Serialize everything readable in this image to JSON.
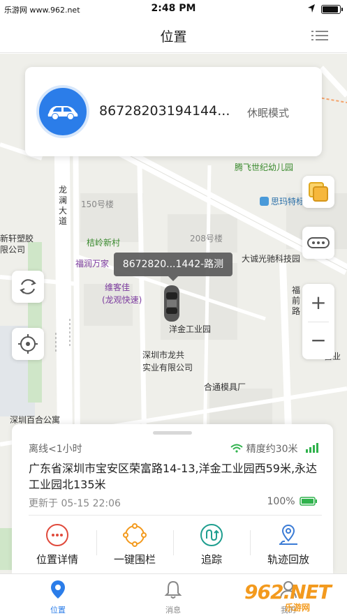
{
  "status_bar": {
    "carrier": "乐游网 www.962.net",
    "time": "2:48 PM"
  },
  "nav": {
    "title": "位置",
    "menu_icon": "list-menu-icon"
  },
  "map": {
    "pois": [
      {
        "name": "poi-tengfei-kindergarten",
        "label": "腾飞世纪幼儿园",
        "color": "green"
      },
      {
        "name": "poi-simatek",
        "label": "思玛特标",
        "color": "blue"
      },
      {
        "name": "poi-150",
        "label": "150号楼",
        "color": "gray"
      },
      {
        "name": "poi-208",
        "label": "208号楼",
        "color": "gray"
      },
      {
        "name": "poi-longlan-dadao",
        "label": "龙澜大道",
        "color": "dark"
      },
      {
        "name": "poi-jieling-xincun",
        "label": "桔岭新村",
        "color": "green"
      },
      {
        "name": "poi-futunwanjia",
        "label": "福润万家",
        "color": "purple"
      },
      {
        "name": "poi-weikejia",
        "label": "维客佳",
        "color": "purple"
      },
      {
        "name": "poi-weikejia-sub",
        "label": "(龙观快速)",
        "color": "purple"
      },
      {
        "name": "poi-dacheng",
        "label": "大诚光驰科技园",
        "color": "dark"
      },
      {
        "name": "poi-yangjin",
        "label": "洋金工业园",
        "color": "dark"
      },
      {
        "name": "poi-shenzhen-longgong",
        "label": "深圳市龙共",
        "color": "dark"
      },
      {
        "name": "poi-shenzhen-longgong-2",
        "label": "实业有限公司",
        "color": "dark"
      },
      {
        "name": "poi-hetong",
        "label": "合通模具厂",
        "color": "dark"
      },
      {
        "name": "poi-baihe",
        "label": "深圳百合公寓",
        "color": "dark"
      },
      {
        "name": "poi-xinxuan",
        "label": "新轩塑胶",
        "color": "dark"
      },
      {
        "name": "poi-xinxuan-2",
        "label": "限公司",
        "color": "dark"
      },
      {
        "name": "poi-fuqian",
        "label": "福前路",
        "color": "dark"
      },
      {
        "name": "poi-fuqian-2",
        "label": "富业",
        "color": "dark"
      }
    ],
    "vehicle_tag": "8672820...1442-路测",
    "map_controls": {
      "layers": "layers-icon",
      "more": "more-icon",
      "zoom_in": "+",
      "zoom_out": "−",
      "refresh": "refresh-icon",
      "locate": "locate-icon"
    }
  },
  "device": {
    "id": "86728203194144...",
    "mode": "休眠模式",
    "avatar_icon": "car-icon"
  },
  "panel": {
    "status": "离线<1小时",
    "accuracy": "精度约30米",
    "address": "广东省深圳市宝安区荣富路14-13,洋金工业园西59米,永达工业园北135米",
    "updated": "更新于 05-15 22:06",
    "battery": "100%",
    "actions": [
      {
        "label": "位置详情",
        "icon": "position-detail-icon",
        "color": "#e04a3c"
      },
      {
        "label": "一键围栏",
        "icon": "geofence-icon",
        "color": "#f39a1e"
      },
      {
        "label": "追踪",
        "icon": "track-icon",
        "color": "#1f9e8f"
      },
      {
        "label": "轨迹回放",
        "icon": "playback-icon",
        "color": "#3a7bd5"
      }
    ]
  },
  "tabs": [
    {
      "label": "位置",
      "active": true
    },
    {
      "label": "消息",
      "active": false
    },
    {
      "label": "我的",
      "active": false
    }
  ],
  "watermark": {
    "logo": "962.NET",
    "sub": "乐游网"
  },
  "colors": {
    "accent": "#2b7de9",
    "map_bg": "#efefea",
    "road": "#ffffff",
    "green_signal": "#2fb24c"
  }
}
